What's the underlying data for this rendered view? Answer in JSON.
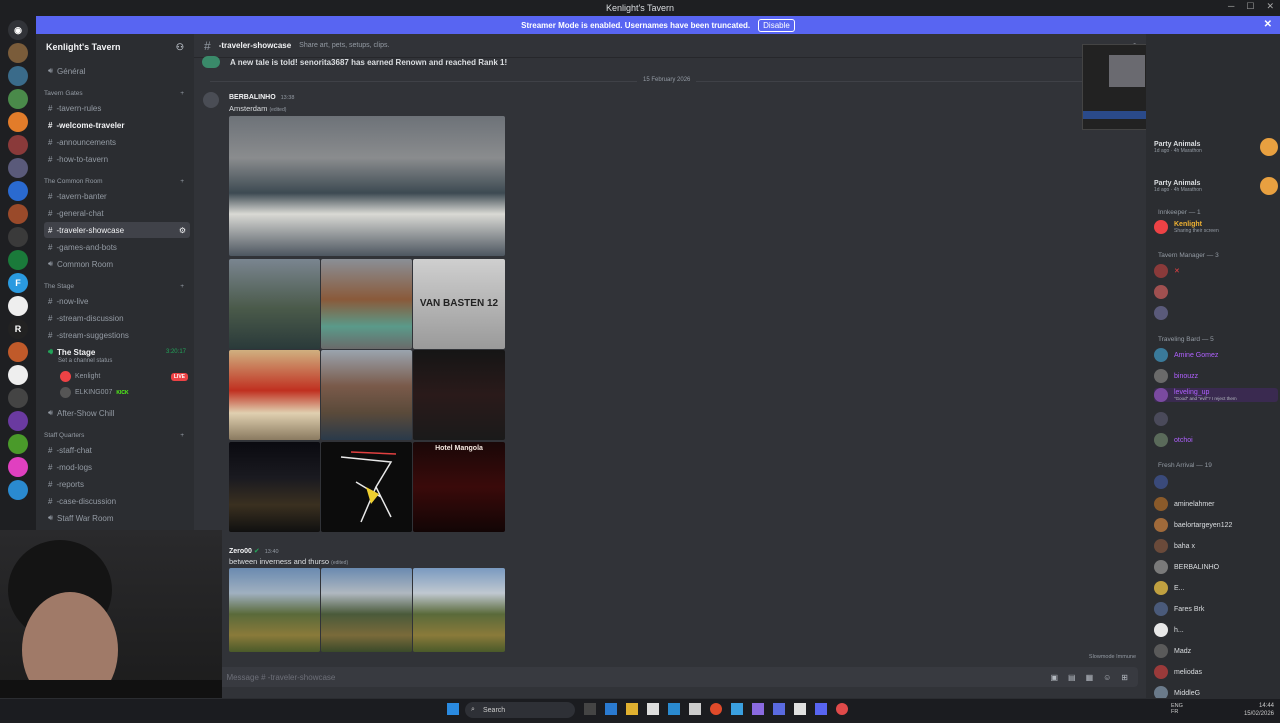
{
  "window": {
    "title": "Kenlight's Tavern"
  },
  "banner": {
    "text": "Streamer Mode is enabled. Usernames have been truncated.",
    "button": "Disable"
  },
  "server": {
    "name": "Kenlight's Tavern"
  },
  "sidebar": {
    "general": "Général",
    "cat_gates": "Tavern Gates",
    "tavern_rules": "-tavern-rules",
    "welcome": "-welcome-traveler",
    "announcements": "-announcements",
    "how_to": "-how-to-tavern",
    "cat_common": "The Common Room",
    "banter": "-tavern-banter",
    "general_chat": "-general-chat",
    "showcase": "-traveler-showcase",
    "games": "-games-and-bots",
    "common_room": "Common Room",
    "cat_stage": "The Stage",
    "now_live": "-now-live",
    "stream_disc": "-stream-discussion",
    "stream_sugg": "-stream-suggestions",
    "the_stage": "The Stage",
    "stage_time": "3:20:17",
    "stage_status": "Set a channel status",
    "user1": "Kenlight",
    "live": "LIVE",
    "user2": "ELKING007",
    "kick": "KICK",
    "after_show": "After-Show Chill",
    "cat_staff": "Staff Quarters",
    "staff_chat": "-staff-chat",
    "mod_logs": "-mod-logs",
    "reports": "-reports",
    "case_disc": "-case-discussion",
    "war_room": "Staff War Room"
  },
  "channel": {
    "name": "-traveler-showcase",
    "topic": "Share art, pets, setups, clips."
  },
  "messages": {
    "system": "A new tale is told! senorita3687 has earned Renown and reached Rank 1!",
    "date": "15 February 2026",
    "m1_author": "BERBALINHO",
    "m1_time": "13:38",
    "m1_text": "Amsterdam",
    "edited": "(edited)",
    "m2_author": "Zero00",
    "m2_time": "13:40",
    "m2_text": "between inverness and thurso",
    "jersey": "VAN BASTEN 12",
    "hotel": "Hotel Mangola"
  },
  "composer": {
    "placeholder": "Message # -traveler-showcase",
    "slowmode": "Slowmode Immune"
  },
  "members": {
    "pa1": "Party Animals",
    "pa1_sub": "1d ago · 4h Marathon",
    "pa2": "Party Animals",
    "pa2_sub": "1d ago · 4h Marathon",
    "cat_innkeeper": "Innkeeper — 1",
    "kenlight": "Kenlight",
    "kenlight_sub": "Sharing their screen",
    "cat_manager": "Tavern Manager — 3",
    "cat_bard": "Traveling Bard — 5",
    "b1": "Amine Gomez",
    "b2": "binouzz",
    "b3": "leveling_up",
    "b3_sub": "\"Good\" and \"evil\"? I reject them",
    "b5": "otchoi",
    "cat_fresh": "Fresh Arrival — 19",
    "f1": "aminelahmer",
    "f2": "baelortargeyen122",
    "f3": "baha x",
    "f4": "BERBALINHO",
    "f5": "E...",
    "f6": "Fares Brk",
    "f7": "h...",
    "f8": "Madz",
    "f9": "meliodas",
    "f10": "MiddleG"
  },
  "taskbar": {
    "search": "Search",
    "lang": "ENG FR",
    "time": "14:44",
    "date": "15/02/2026"
  },
  "colors": {
    "accent": "#5865f2",
    "live": "#ed4245",
    "online": "#23a55a"
  }
}
